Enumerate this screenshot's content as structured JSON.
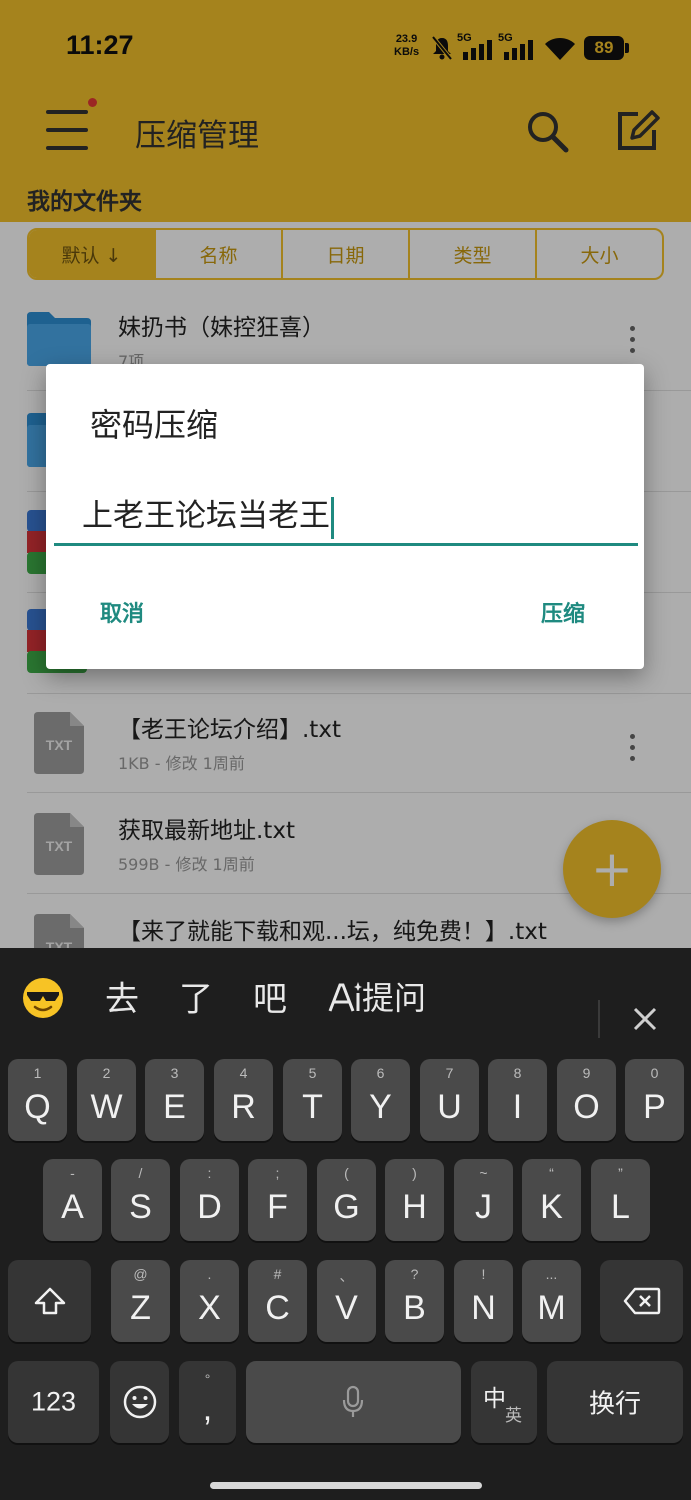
{
  "status_bar": {
    "time": "11:27",
    "net_speed": "23.9",
    "net_unit": "KB/s",
    "sim1": "5G",
    "sim2": "5G",
    "battery": "89"
  },
  "app_bar": {
    "title": "压缩管理",
    "folder_title": "我的文件夹",
    "icons": [
      "menu-icon",
      "search-icon",
      "edit-icon"
    ]
  },
  "sort_tabs": [
    "默认 ↓",
    "名称",
    "日期",
    "类型",
    "大小"
  ],
  "files": [
    {
      "name": "妹扔书（妹控狂喜）",
      "meta": "7项",
      "type": "folder"
    },
    {
      "name": "",
      "meta": "",
      "type": "folder"
    },
    {
      "name": "",
      "meta": "",
      "type": "archive"
    },
    {
      "name": "",
      "meta": "",
      "type": "archive"
    },
    {
      "name": "【老王论坛介绍】.txt",
      "meta": "1KB - 修改 1周前",
      "type": "txt"
    },
    {
      "name": "获取最新地址.txt",
      "meta": "599B - 修改 1周前",
      "type": "txt"
    },
    {
      "name": "【来了就能下载和观...坛，纯免费！】.txt",
      "meta": "",
      "type": "txt"
    }
  ],
  "txt_icon_label": "TXT",
  "fab": {
    "icon": "plus-icon",
    "label": "+"
  },
  "dialog": {
    "title": "密码压缩",
    "input_value": "上老王论坛当老王",
    "cancel": "取消",
    "confirm": "压缩"
  },
  "keyboard": {
    "suggestions": [
      "去",
      "了",
      "吧"
    ],
    "ai_label": "提问",
    "row1": [
      {
        "k": "Q",
        "h": "1"
      },
      {
        "k": "W",
        "h": "2"
      },
      {
        "k": "E",
        "h": "3"
      },
      {
        "k": "R",
        "h": "4"
      },
      {
        "k": "T",
        "h": "5"
      },
      {
        "k": "Y",
        "h": "6"
      },
      {
        "k": "U",
        "h": "7"
      },
      {
        "k": "I",
        "h": "8"
      },
      {
        "k": "O",
        "h": "9"
      },
      {
        "k": "P",
        "h": "0"
      }
    ],
    "row2": [
      {
        "k": "A",
        "h": "-"
      },
      {
        "k": "S",
        "h": "/"
      },
      {
        "k": "D",
        "h": ":"
      },
      {
        "k": "F",
        "h": ";"
      },
      {
        "k": "G",
        "h": "("
      },
      {
        "k": "H",
        "h": ")"
      },
      {
        "k": "J",
        "h": "~"
      },
      {
        "k": "K",
        "h": "“"
      },
      {
        "k": "L",
        "h": "”"
      }
    ],
    "row3": [
      {
        "k": "Z",
        "h": "@"
      },
      {
        "k": "X",
        "h": "."
      },
      {
        "k": "C",
        "h": "#"
      },
      {
        "k": "V",
        "h": "、"
      },
      {
        "k": "B",
        "h": "?"
      },
      {
        "k": "N",
        "h": "!"
      },
      {
        "k": "M",
        "h": "..."
      }
    ],
    "num_key": "123",
    "comma_key": ",",
    "comma_hint": "°",
    "lang_main": "中",
    "lang_sub": "英",
    "enter_key": "换行"
  }
}
